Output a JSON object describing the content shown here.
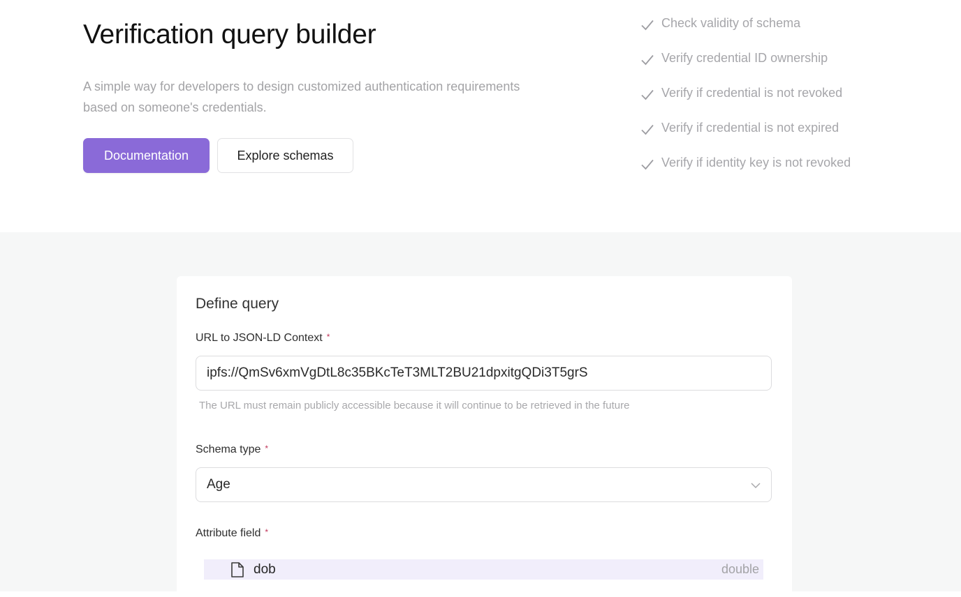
{
  "header": {
    "title": "Verification query builder",
    "description": "A simple way for developers to design customized authentication requirements based on someone's credentials.",
    "primary_button": "Documentation",
    "secondary_button": "Explore schemas"
  },
  "checks": [
    "Check validity of schema",
    "Verify credential ID ownership",
    "Verify if credential is not revoked",
    "Verify if credential is not expired",
    "Verify if identity key is not revoked"
  ],
  "query": {
    "title": "Define query",
    "url_label": "URL to JSON-LD Context",
    "url_value": "ipfs://QmSv6xmVgDtL8c35BKcTeT3MLT2BU21dpxitgQDi3T5grS",
    "url_hint": "The URL must remain publicly accessible because it will continue to be retrieved in the future",
    "schema_label": "Schema type",
    "schema_value": "Age",
    "attribute_label": "Attribute field",
    "attribute": {
      "name": "dob",
      "type": "double"
    },
    "required_mark": "*"
  },
  "colors": {
    "accent": "#8a6ad8",
    "required": "#c0365a",
    "selected_row": "#f1eefb",
    "muted_text": "#a6a6aa"
  },
  "icons": {
    "check": "check-icon",
    "chevron": "chevron-down-icon",
    "attribute": "document-icon"
  }
}
